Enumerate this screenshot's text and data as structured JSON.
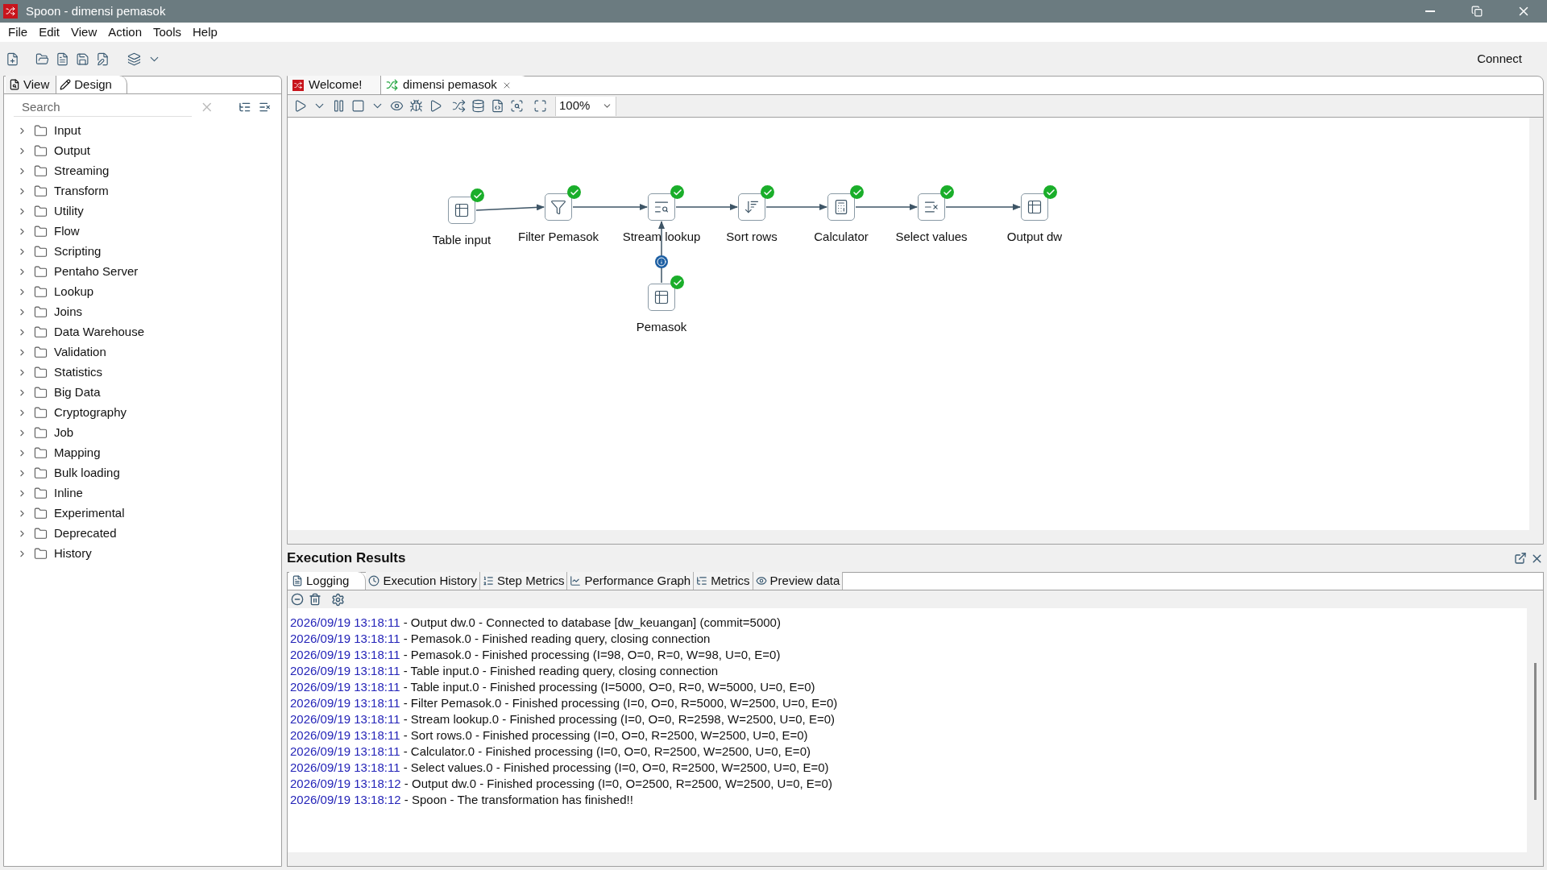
{
  "window": {
    "title": "Spoon - dimensi pemasok"
  },
  "menu": [
    "File",
    "Edit",
    "View",
    "Action",
    "Tools",
    "Help"
  ],
  "toolbar": {
    "connect": "Connect"
  },
  "left_tabs": [
    {
      "label": "View",
      "selected": false,
      "kind": "view"
    },
    {
      "label": "Design",
      "selected": true,
      "kind": "design"
    }
  ],
  "search": {
    "placeholder": "Search"
  },
  "categories": [
    "Input",
    "Output",
    "Streaming",
    "Transform",
    "Utility",
    "Flow",
    "Scripting",
    "Pentaho Server",
    "Lookup",
    "Joins",
    "Data Warehouse",
    "Validation",
    "Statistics",
    "Big Data",
    "Cryptography",
    "Job",
    "Mapping",
    "Bulk loading",
    "Inline",
    "Experimental",
    "Deprecated",
    "History"
  ],
  "editor_tabs": [
    {
      "label": "Welcome!",
      "selected": false,
      "kind": "welcome"
    },
    {
      "label": "dimensi pemasok",
      "selected": true,
      "kind": "transformation"
    }
  ],
  "zoom": "100%",
  "steps": [
    {
      "label": "Table input",
      "kind": "table-input",
      "finished": true
    },
    {
      "label": "Filter Pemasok",
      "kind": "filter",
      "finished": true
    },
    {
      "label": "Stream lookup",
      "kind": "lookup",
      "finished": true
    },
    {
      "label": "Sort rows",
      "kind": "sort",
      "finished": true
    },
    {
      "label": "Calculator",
      "kind": "calculator",
      "finished": true
    },
    {
      "label": "Select values",
      "kind": "select",
      "finished": true
    },
    {
      "label": "Output dw",
      "kind": "output",
      "finished": true
    },
    {
      "label": "Pemasok",
      "kind": "table-input",
      "finished": true
    }
  ],
  "results": {
    "title": "Execution Results",
    "tabs": [
      {
        "label": "Logging",
        "selected": true,
        "kind": "logging"
      },
      {
        "label": "Execution History",
        "selected": false,
        "kind": "history"
      },
      {
        "label": "Step Metrics",
        "selected": false,
        "kind": "step-metrics"
      },
      {
        "label": "Performance Graph",
        "selected": false,
        "kind": "graph"
      },
      {
        "label": "Metrics",
        "selected": false,
        "kind": "metrics"
      },
      {
        "label": "Preview data",
        "selected": false,
        "kind": "preview"
      }
    ],
    "log": [
      {
        "time": "2026/09/19 13:18:11",
        "message": "- Output dw.0 - Connected to database [dw_keuangan] (commit=5000)"
      },
      {
        "time": "2026/09/19 13:18:11",
        "message": "- Pemasok.0 - Finished reading query, closing connection"
      },
      {
        "time": "2026/09/19 13:18:11",
        "message": "- Pemasok.0 - Finished processing (I=98, O=0, R=0, W=98, U=0, E=0)"
      },
      {
        "time": "2026/09/19 13:18:11",
        "message": "- Table input.0 - Finished reading query, closing connection"
      },
      {
        "time": "2026/09/19 13:18:11",
        "message": "- Table input.0 - Finished processing (I=5000, O=0, R=0, W=5000, U=0, E=0)"
      },
      {
        "time": "2026/09/19 13:18:11",
        "message": "- Filter Pemasok.0 - Finished processing (I=0, O=0, R=5000, W=2500, U=0, E=0)"
      },
      {
        "time": "2026/09/19 13:18:11",
        "message": "- Stream lookup.0 - Finished processing (I=0, O=0, R=2598, W=2500, U=0, E=0)"
      },
      {
        "time": "2026/09/19 13:18:11",
        "message": "- Sort rows.0 - Finished processing (I=0, O=0, R=2500, W=2500, U=0, E=0)"
      },
      {
        "time": "2026/09/19 13:18:11",
        "message": "- Calculator.0 - Finished processing (I=0, O=0, R=2500, W=2500, U=0, E=0)"
      },
      {
        "time": "2026/09/19 13:18:11",
        "message": "- Select values.0 - Finished processing (I=0, O=0, R=2500, W=2500, U=0, E=0)"
      },
      {
        "time": "2026/09/19 13:18:12",
        "message": "- Output dw.0 - Finished processing (I=0, O=2500, R=2500, W=2500, U=0, E=0)"
      },
      {
        "time": "2026/09/19 13:18:12",
        "message": "- Spoon - The transformation has finished!!"
      }
    ]
  }
}
